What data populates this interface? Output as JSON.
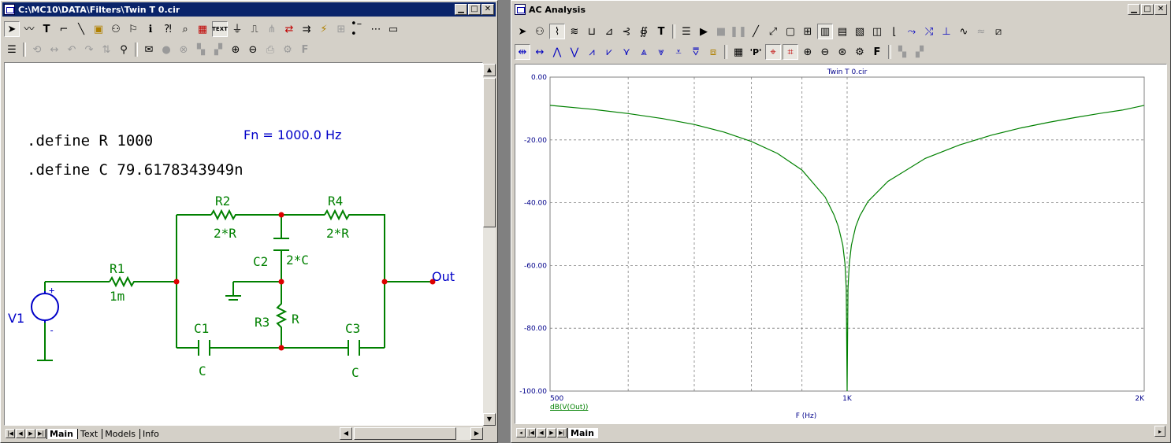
{
  "schematic": {
    "title": "C:\\MC10\\DATA\\Filters\\Twin T 0.cir",
    "define_r": ".define R 1000",
    "define_c": ".define C 79.6178343949n",
    "fn_text": "Fn = 1000.0 Hz",
    "components": {
      "r2_name": "R2",
      "r2_value": "2*R",
      "r4_name": "R4",
      "r4_value": "2*R",
      "r1_name": "R1",
      "r1_value": "1m",
      "c2_name": "C2",
      "c2_value": "2*C",
      "r3_name": "R3",
      "r3_value": "R",
      "c1_name": "C1",
      "c1_value": "C",
      "c3_name": "C3",
      "c3_value": "C",
      "v1_name": "V1",
      "v1_plus": "+",
      "v1_minus": "-",
      "out_label": "Out"
    },
    "tabs": [
      "Main",
      "Text",
      "Models",
      "Info"
    ],
    "toolbar1_icons": [
      "select-arrow-icon",
      "wire-icon",
      "text-tool-icon",
      "wire-ortho-icon",
      "line-icon",
      "info-box-icon",
      "component-icon",
      "flag-icon",
      "info-icon",
      "help-icon",
      "find-icon",
      "stepping-icon",
      "text-toggle-icon",
      "node-numbers-icon",
      "pin-icon",
      "grid-icon",
      "swap-icon",
      "probe-icon",
      "attach-icon",
      "zoom-icon",
      "dots-icon",
      "frame-icon",
      "cursor-icon"
    ],
    "toolbar1_labels": {
      "text_btn": "TEXT"
    },
    "toolbar2_icons": [
      "properties-icon",
      "rotate-icon",
      "flip-x-icon",
      "undo-icon",
      "redo-icon",
      "mirror-icon",
      "binoculars-icon",
      "comment-icon",
      "check-icon",
      "stop-icon",
      "back-icon",
      "front-icon",
      "zoom-in-icon",
      "zoom-out-icon",
      "print-icon",
      "settings-icon",
      "font-icon"
    ],
    "toolbar2_labels": {
      "font_btn": "F"
    }
  },
  "analysis": {
    "title": "AC Analysis",
    "plot_title": "Twin T 0.cir",
    "trace_label": "dB(V(Out))",
    "tabs": [
      "Main"
    ],
    "toolbar1_icons": [
      "select-arrow-icon",
      "component-icon",
      "graph-icon",
      "tabular-icon",
      "swap-icon",
      "scale-icon",
      "toggle-icon",
      "math-icon",
      "text-tool-icon",
      "properties-icon",
      "run-icon",
      "stop-icon",
      "pause-icon",
      "line-icon",
      "diagonal-icon",
      "grid-box-icon",
      "grid-fine-icon",
      "table-1-icon",
      "table-2-icon",
      "table-3-icon",
      "table-4-icon",
      "axis-icon",
      "tangent-icon",
      "slope-icon",
      "baseline-icon",
      "sine-icon",
      "wave-icon",
      "export-icon"
    ],
    "toolbar1_labels": {
      "text_btn": "T"
    },
    "toolbar2_icons": [
      "cursor-h-icon",
      "cursor-move-icon",
      "peak-icon",
      "valley-icon",
      "high-icon",
      "low-icon",
      "inflection-icon",
      "global-high-icon",
      "global-low-icon",
      "top-icon",
      "bottom-icon",
      "settings-box-icon",
      "data-icon",
      "point-tag-icon",
      "horizontal-tag-icon",
      "vertical-tag-icon",
      "zoom-in-icon",
      "zoom-out-icon",
      "zoom-fit-icon",
      "settings-icon",
      "font-icon",
      "back-icon",
      "front-icon"
    ],
    "toolbar2_labels": {
      "point_btn": "'P'",
      "font_btn": "F"
    }
  },
  "chart_data": {
    "type": "line",
    "title": "Twin T 0.cir",
    "xlabel": "F (Hz)",
    "ylabel": "",
    "x_scale": "log",
    "xlim": [
      500,
      2000
    ],
    "ylim": [
      -100,
      0
    ],
    "x_ticks": [
      {
        "value": 500,
        "label": "500"
      },
      {
        "value": 1000,
        "label": "1K"
      },
      {
        "value": 2000,
        "label": "2K"
      }
    ],
    "y_ticks": [
      {
        "value": 0,
        "label": "0.00"
      },
      {
        "value": -20,
        "label": "-20.00"
      },
      {
        "value": -40,
        "label": "-40.00"
      },
      {
        "value": -60,
        "label": "-60.00"
      },
      {
        "value": -80,
        "label": "-80.00"
      },
      {
        "value": -100,
        "label": "-100.00"
      }
    ],
    "grid": true,
    "series": [
      {
        "name": "dB(V(Out))",
        "color": "#008000",
        "x": [
          500,
          550,
          600,
          650,
          700,
          750,
          800,
          850,
          900,
          950,
          970,
          980,
          990,
          995,
          998,
          1000,
          1002,
          1005,
          1010,
          1020,
          1030,
          1050,
          1100,
          1200,
          1300,
          1400,
          1500,
          1600,
          1700,
          1800,
          1900,
          2000
        ],
        "y": [
          -9.0,
          -10.2,
          -11.6,
          -13.2,
          -15.1,
          -17.5,
          -20.5,
          -24.3,
          -29.6,
          -38.2,
          -43.9,
          -47.7,
          -53.5,
          -59.5,
          -67.4,
          -100,
          -67.4,
          -59.6,
          -53.6,
          -47.7,
          -44.2,
          -39.6,
          -33.2,
          -25.9,
          -21.6,
          -18.5,
          -16.2,
          -14.4,
          -12.9,
          -11.6,
          -10.5,
          -9.0
        ]
      }
    ]
  },
  "colors": {
    "title_active": "#0a246a",
    "window_face": "#d4d0c8",
    "schematic_green": "#008000",
    "schematic_blue": "#0000c8",
    "node_red": "#dd0000",
    "plot_axis_text": "#00008b"
  }
}
